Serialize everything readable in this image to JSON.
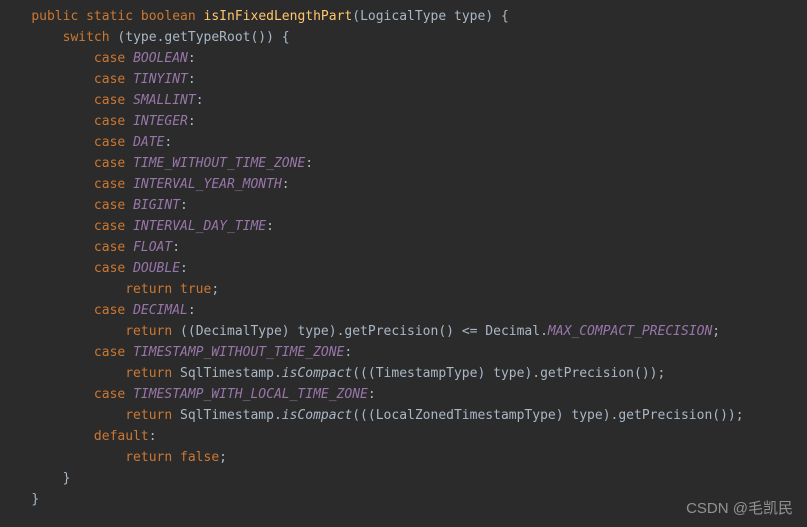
{
  "sig": {
    "mod_public": "public",
    "mod_static": "static",
    "ret": "boolean",
    "name": "isInFixedLengthPart",
    "param_type": "LogicalType",
    "param_name": "type"
  },
  "switch_kw": "switch",
  "switch_expr_obj": "type",
  "switch_expr_call": "getTypeRoot",
  "case_kw": "case",
  "return_kw": "return",
  "true_kw": "true",
  "false_kw": "false",
  "default_kw": "default",
  "cases": {
    "c0": "BOOLEAN",
    "c1": "TINYINT",
    "c2": "SMALLINT",
    "c3": "INTEGER",
    "c4": "DATE",
    "c5": "TIME_WITHOUT_TIME_ZONE",
    "c6": "INTERVAL_YEAR_MONTH",
    "c7": "BIGINT",
    "c8": "INTERVAL_DAY_TIME",
    "c9": "FLOAT",
    "c10": "DOUBLE",
    "c11": "DECIMAL",
    "c12": "TIMESTAMP_WITHOUT_TIME_ZONE",
    "c13": "TIMESTAMP_WITH_LOCAL_TIME_ZONE"
  },
  "dec": {
    "cast": "DecimalType",
    "var": "type",
    "call": "getPrecision",
    "cls": "Decimal",
    "field": "MAX_COMPACT_PRECISION",
    "op": "<="
  },
  "ts": {
    "cls": "SqlTimestamp",
    "method": "isCompact",
    "cast1": "TimestampType",
    "cast2": "LocalZonedTimestampType",
    "var": "type",
    "call": "getPrecision"
  },
  "watermark": "CSDN @毛凯民"
}
